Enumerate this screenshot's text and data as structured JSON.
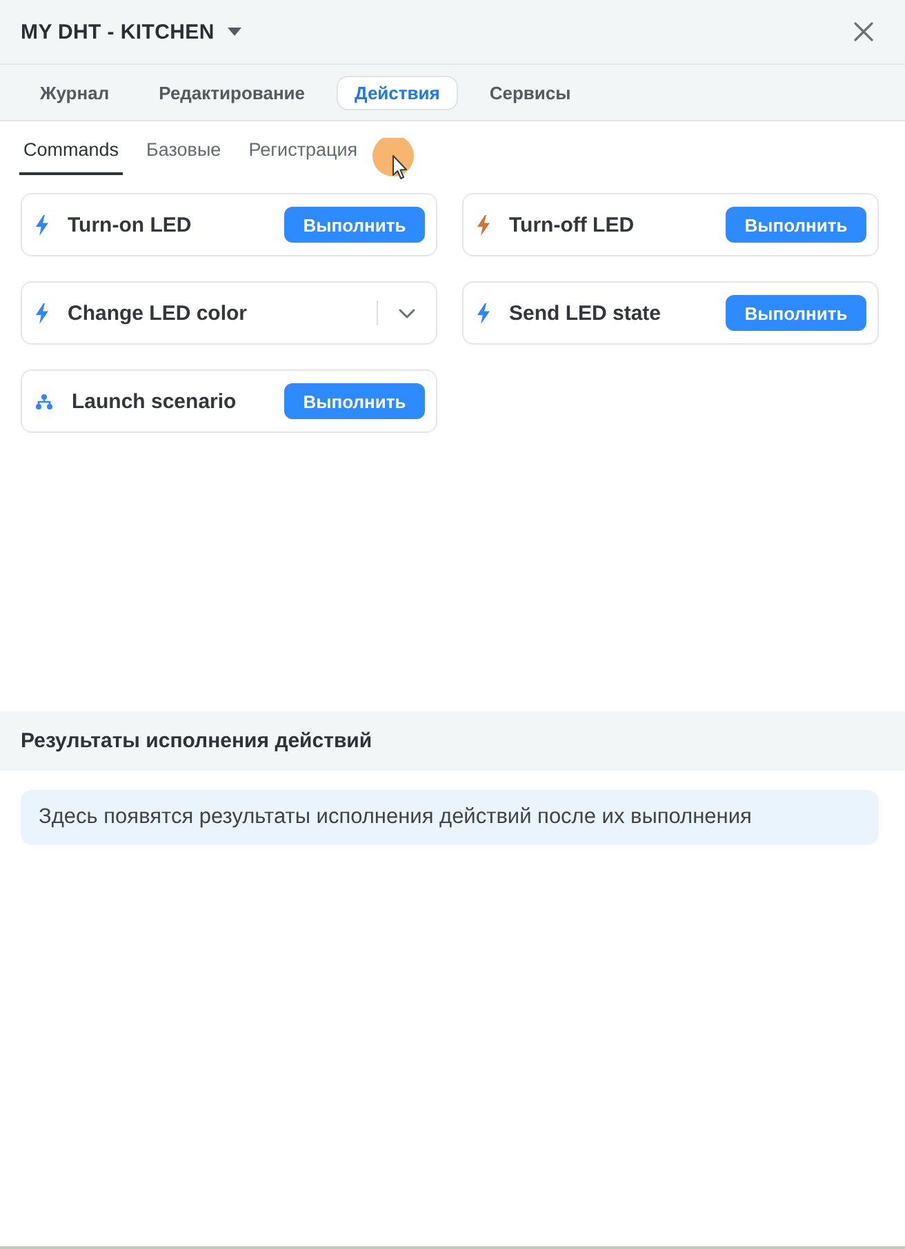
{
  "header": {
    "title": "MY DHT - KITCHEN"
  },
  "tabs": [
    {
      "label": "Журнал",
      "selected": false
    },
    {
      "label": "Редактирование",
      "selected": false
    },
    {
      "label": "Действия",
      "selected": true
    },
    {
      "label": "Сервисы",
      "selected": false
    }
  ],
  "subtabs": [
    {
      "label": "Commands",
      "selected": true
    },
    {
      "label": "Базовые",
      "selected": false
    },
    {
      "label": "Регистрация",
      "selected": false
    }
  ],
  "commands": [
    {
      "name": "Turn-on LED",
      "kind": "command",
      "color": "#2f86f6",
      "button": "Выполнить"
    },
    {
      "name": "Turn-off LED",
      "kind": "command",
      "color": "#c8763c",
      "button": "Выполнить"
    },
    {
      "name": "Change LED color",
      "kind": "command",
      "color": "#2f86f6",
      "expanded": false
    },
    {
      "name": "Send LED state",
      "kind": "command",
      "color": "#2f86f6",
      "button": "Выполнить"
    },
    {
      "name": "Launch scenario",
      "kind": "scenario",
      "color": "#2f86f6",
      "button": "Выполнить"
    }
  ],
  "results": {
    "title": "Результаты исполнения действий",
    "message": "Здесь появятся результаты исполнения действий после их выполнения"
  }
}
